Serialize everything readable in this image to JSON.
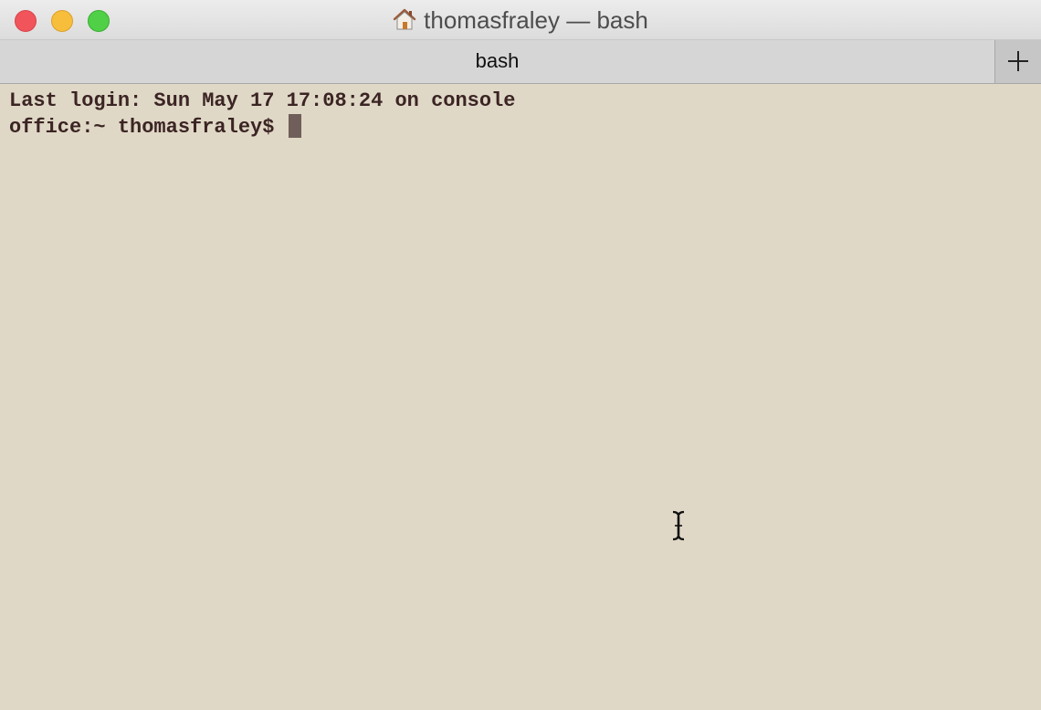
{
  "window": {
    "title": "thomasfraley — bash",
    "title_icon": "home-icon"
  },
  "tabs": [
    {
      "label": "bash",
      "active": true
    }
  ],
  "new_tab_icon": "plus-icon",
  "terminal": {
    "lines": [
      "Last login: Sun May 17 17:08:24 on console",
      "office:~ thomasfraley$ "
    ],
    "background_color": "#e0d8c6",
    "text_color": "#3b2424",
    "cursor_color": "#6f5e5a"
  },
  "colors": {
    "close": "#f2545b",
    "minimize": "#f6be3b",
    "zoom": "#4fd046"
  }
}
